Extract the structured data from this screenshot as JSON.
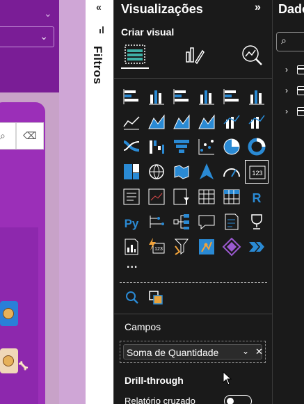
{
  "canvas": {
    "background": "#c8a2c8",
    "panel_color": "#9b2fb8"
  },
  "filters_pane": {
    "label": "Filtros",
    "collapse_glyph": "«"
  },
  "visualizations_pane": {
    "title": "Visualizações",
    "expand_glyph": "»",
    "subtitle": "Criar visual",
    "modes": [
      "build-visual-icon",
      "format-visual-icon",
      "analytics-icon"
    ],
    "visual_icons": [
      "stacked-bar-chart-icon",
      "stacked-column-chart-icon",
      "clustered-bar-chart-icon",
      "clustered-column-chart-icon",
      "100-stacked-bar-chart-icon",
      "100-stacked-column-chart-icon",
      "line-chart-icon",
      "area-chart-icon",
      "stacked-area-chart-icon",
      "100-stacked-area-chart-icon",
      "line-clustered-column-chart-icon",
      "line-stacked-column-chart-icon",
      "ribbon-chart-icon",
      "waterfall-chart-icon",
      "funnel-chart-icon",
      "scatter-chart-icon",
      "pie-chart-icon",
      "donut-chart-icon",
      "treemap-icon",
      "map-icon",
      "filled-map-icon",
      "azure-map-icon",
      "gauge-icon",
      "card-icon",
      "multi-row-card-icon",
      "kpi-icon",
      "slicer-icon",
      "table-icon",
      "matrix-icon",
      "r-visual-icon",
      "python-visual-icon",
      "key-influencers-icon",
      "decomposition-tree-icon",
      "qa-icon",
      "smart-narrative-icon",
      "metrics-icon",
      "paginated-report-icon",
      "power-automate-icon",
      "power-apps-icon",
      "arcgis-map-icon",
      "diamond-visual-icon",
      "chevron-visual-icon"
    ],
    "more_label": "...",
    "tools": [
      "search-visuals-icon",
      "format-painter-icon"
    ],
    "fields_label": "Campos",
    "field_pill": "Soma de Quantidade",
    "drillthrough_label": "Drill-through",
    "cross_report_label": "Relatório cruzado",
    "accent": "#2a8ad4",
    "teal": "#3fb0a6"
  },
  "data_pane": {
    "title": "Dados",
    "search_icon": "search-icon",
    "tables": 3
  }
}
